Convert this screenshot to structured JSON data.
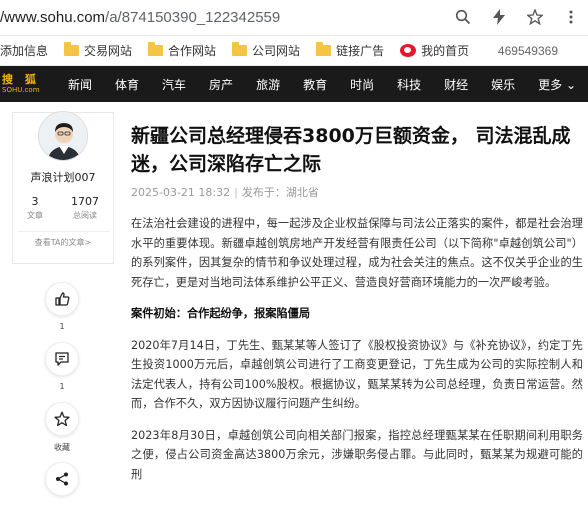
{
  "browser": {
    "url_host": "/www.sohu.com",
    "url_path": "/a/874150390_122342559"
  },
  "bookmarks": {
    "items": [
      "添加信息",
      "交易网站",
      "合作网站",
      "公司网站",
      "链接广告",
      "我的首页"
    ],
    "right_text": "469549369"
  },
  "site": {
    "logo_top": "搜 狐",
    "logo_bottom": "SOHU.com",
    "nav": [
      "新闻",
      "体育",
      "汽车",
      "房产",
      "旅游",
      "教育",
      "时尚",
      "科技",
      "财经",
      "娱乐"
    ],
    "more": "更多 ⌄"
  },
  "author": {
    "name": "声浪计划007",
    "articles_count": "3",
    "articles_label": "文章",
    "reads_count": "1707",
    "reads_label": "总阅读",
    "link": "查看TA的文章>"
  },
  "actions": {
    "like_count": "1",
    "comment_count": "1",
    "collect_label": "收藏"
  },
  "article": {
    "title": "新疆公司总经理侵吞3800万巨额资金， 司法混乱成迷，公司深陷存亡之际",
    "date": "2025-03-21 18:32",
    "location": "发布于：湖北省",
    "paragraphs": [
      {
        "text": "在法治社会建设的进程中，每一起涉及企业权益保障与司法公正落实的案件，都是社会治理水平的重要体现。新疆卓越创筑房地产开发经营有限责任公司（以下简称\"卓越创筑公司\"）的系列案件，因其复杂的情节和争议处理过程，成为社会关注的焦点。这不仅关乎企业的生死存亡，更是对当地司法体系维护公平正义、营造良好营商环境能力的一次严峻考验。",
        "heading": false
      },
      {
        "text": "案件初始：合作起纷争，报案陷僵局",
        "heading": true
      },
      {
        "text": "2020年7月14日，丁先生、甄某某等人签订了《股权投资协议》与《补充协议》，约定丁先生投资1000万元后，卓越创筑公司进行了工商变更登记，丁先生成为公司的实际控制人和法定代表人，持有公司100%股权。根据协议，甄某某转为公司总经理，负责日常运营。然而，合作不久，双方因协议履行问题产生纠纷。",
        "heading": false
      },
      {
        "text": "2023年8月30日，卓越创筑公司向相关部门报案，指控总经理甄某某在任职期间利用职务之便，侵占公司资金高达3800万余元，涉嫌职务侵占罪。与此同时，甄某某为规避可能的刑",
        "heading": false
      }
    ]
  }
}
